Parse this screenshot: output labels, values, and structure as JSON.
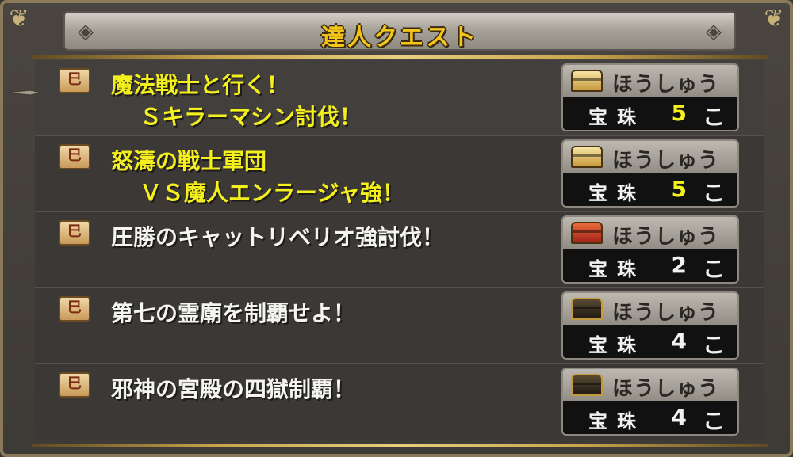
{
  "header": {
    "title": "達人クエスト"
  },
  "quests": [
    {
      "title_line1": "魔法戦士と行く！",
      "title_line2": "Ｓキラーマシン討伐！",
      "highlight": true,
      "reward": {
        "label": "ほうしゅう",
        "item": "宝珠",
        "qty": "5",
        "unit": "こ",
        "chest": "gold"
      }
    },
    {
      "title_line1": "怒濤の戦士軍団",
      "title_line2": "ＶＳ魔人エンラージャ強！",
      "highlight": true,
      "reward": {
        "label": "ほうしゅう",
        "item": "宝珠",
        "qty": "5",
        "unit": "こ",
        "chest": "gold"
      }
    },
    {
      "title_line1": "圧勝のキャットリベリオ強討伐！",
      "title_line2": "",
      "highlight": false,
      "reward": {
        "label": "ほうしゅう",
        "item": "宝珠",
        "qty": "2",
        "unit": "こ",
        "chest": "red"
      }
    },
    {
      "title_line1": "第七の霊廟を制覇せよ！",
      "title_line2": "",
      "highlight": false,
      "reward": {
        "label": "ほうしゅう",
        "item": "宝珠",
        "qty": "4",
        "unit": "こ",
        "chest": "black"
      }
    },
    {
      "title_line1": "邪神の宮殿の四獄制覇！",
      "title_line2": "",
      "highlight": false,
      "reward": {
        "label": "ほうしゅう",
        "item": "宝珠",
        "qty": "4",
        "unit": "こ",
        "chest": "black"
      }
    }
  ],
  "icons": {
    "quest_icon": "scroll-icon",
    "nav_left": "swirl-left-icon",
    "nav_right": "swirl-right-icon",
    "cursor": "sword-cursor-icon"
  },
  "colors": {
    "title_gold": "#f2c51a",
    "highlight_text": "#f4f01e",
    "normal_text": "#f5f5f0"
  }
}
